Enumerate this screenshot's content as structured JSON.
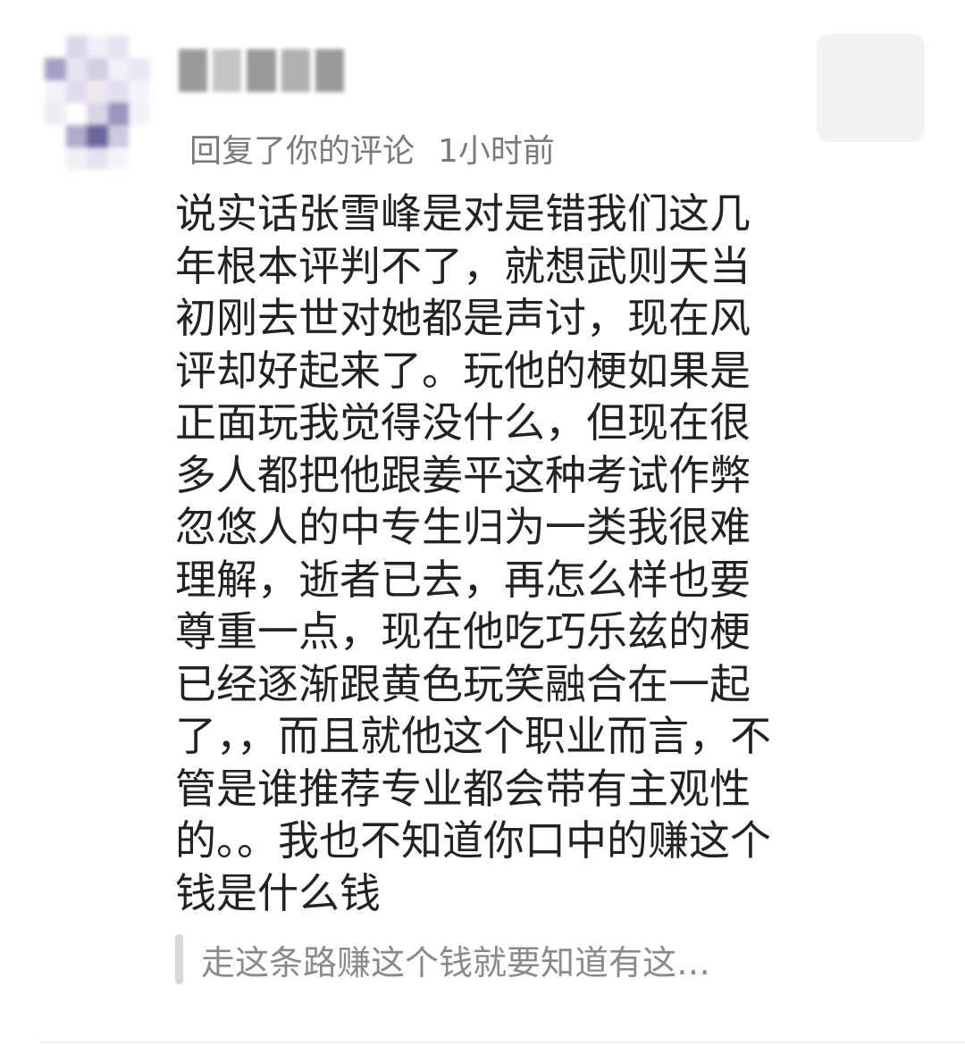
{
  "comment": {
    "meta": {
      "action": "回复了你的评论",
      "time": "1小时前"
    },
    "body": "说实话张雪峰是对是错我们这几年根本评判不了，就想武则天当初刚去世对她都是声讨，现在风评却好起来了。玩他的梗如果是正面玩我觉得没什么，但现在很多人都把他跟姜平这种考试作弊忽悠人的中专生归为一类我很难理解，逝者已去，再怎么样也要尊重一点，现在他吃巧乐兹的梗已经逐渐跟黄色玩笑融合在一起了，，而且就他这个职业而言，不管是谁推荐专业都会带有主观性的。。我也不知道你口中的赚这个钱是什么钱",
    "quote": "走这条路赚这个钱就要知道有这…"
  },
  "icons": {
    "avatar": "blurred-avatar-icon",
    "thumbnail": "post-thumbnail-image"
  },
  "colors": {
    "body_text": "#222222",
    "meta_text": "#7a7a7a",
    "quote_text": "#8a8a8a",
    "quote_bar": "#d8d8d8",
    "thumbnail_bg": "#f2f2f2"
  }
}
